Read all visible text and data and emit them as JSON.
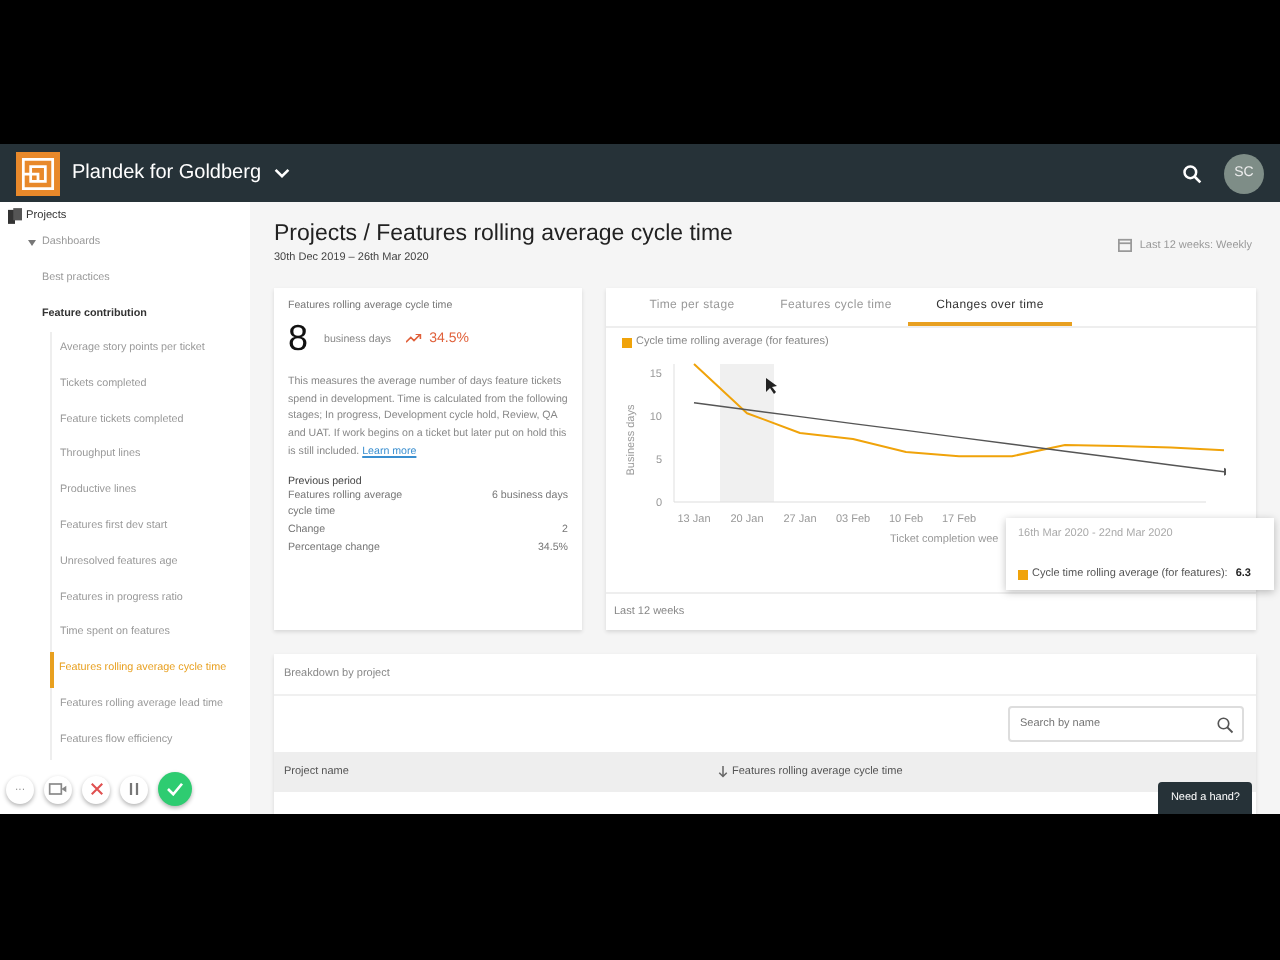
{
  "app_bar": {
    "title": "Plandek for Goldberg",
    "avatar": "SC"
  },
  "sidebar": {
    "root": "Projects",
    "section": {
      "label": "Dashboards",
      "expanded": true
    },
    "groups": [
      {
        "label": "Best practices",
        "bold": false
      },
      {
        "label": "Feature contribution",
        "bold": true
      }
    ],
    "items": [
      {
        "label": "Average story points per ticket",
        "selected": false
      },
      {
        "label": "Tickets completed",
        "selected": false
      },
      {
        "label": "Feature tickets completed",
        "selected": false
      },
      {
        "label": "Throughput lines",
        "selected": false
      },
      {
        "label": "Productive lines",
        "selected": false
      },
      {
        "label": "Features first dev start",
        "selected": false
      },
      {
        "label": "Unresolved features age",
        "selected": false
      },
      {
        "label": "Features in progress ratio",
        "selected": false
      },
      {
        "label": "Time spent on features",
        "selected": false
      },
      {
        "label": "Features rolling average cycle time",
        "selected": true
      },
      {
        "label": "Features rolling average lead time",
        "selected": false
      },
      {
        "label": "Features flow efficiency",
        "selected": false
      }
    ]
  },
  "toolbar": [
    {
      "kind": "more",
      "label": "···"
    },
    {
      "kind": "camera"
    },
    {
      "kind": "cancel"
    },
    {
      "kind": "pause"
    },
    {
      "kind": "confirm"
    }
  ],
  "header": {
    "title": "Projects / Features rolling average cycle time",
    "dates": "30th Dec 2019 – 26th Mar 2020",
    "period": "Last 12 weeks: Weekly"
  },
  "summary": {
    "title": "Features rolling average cycle time",
    "value": "8",
    "unit": "business days",
    "change": "34.5%",
    "description": "This measures the average number of days feature tickets spend in development. Time is calculated from the following stages; In progress, Development cycle hold, Review, QA and UAT. If work begins on a ticket but later put on hold this is still included.",
    "link": "Learn more",
    "previous_heading": "Previous period",
    "previous": [
      {
        "label": "Features rolling average cycle time",
        "value": "6 business days"
      },
      {
        "label": "Change",
        "value": "2"
      },
      {
        "label": "Percentage change",
        "value": "34.5%"
      }
    ]
  },
  "chart_card": {
    "tabs": [
      {
        "label": "Time per stage",
        "selected": false
      },
      {
        "label": "Features cycle time",
        "selected": false
      },
      {
        "label": "Changes over time",
        "selected": true
      }
    ],
    "chart_data": {
      "type": "line",
      "ylabel": "Business days",
      "xlabel": "Ticket completion wee",
      "categories": [
        "13 Jan",
        "20 Jan",
        "27 Jan",
        "03 Feb",
        "10 Feb",
        "17 Feb",
        null,
        null,
        null,
        null,
        null
      ],
      "yticks": [
        0,
        5,
        10,
        15
      ],
      "ylim": [
        0,
        16
      ],
      "series": [
        {
          "name": "Cycle time rolling average (for features)",
          "color": "#f0a30a",
          "values": [
            16,
            10.3,
            8,
            7.3,
            5.8,
            5.3,
            5.3,
            6.6,
            6.5,
            6.3,
            6.0
          ]
        },
        {
          "color": "#555555",
          "values": [
            11.5,
            10.7,
            9.9,
            9.1,
            8.3,
            7.5,
            6.7,
            5.9,
            5.1,
            4.3,
            3.5
          ]
        }
      ]
    },
    "tooltip": {
      "title": "16th Mar 2020 - 22nd Mar 2020",
      "label": "Cycle time rolling average (for features):",
      "value": "6.3"
    },
    "footer": "Last 12 weeks"
  },
  "breakdown": {
    "title": "Breakdown by project",
    "search": {
      "placeholder": "Search by name"
    },
    "columns": [
      {
        "label": "Project name",
        "sorted": false
      },
      {
        "label": "Features rolling average cycle time",
        "sorted": true
      }
    ]
  },
  "help_button": "Need a hand?"
}
